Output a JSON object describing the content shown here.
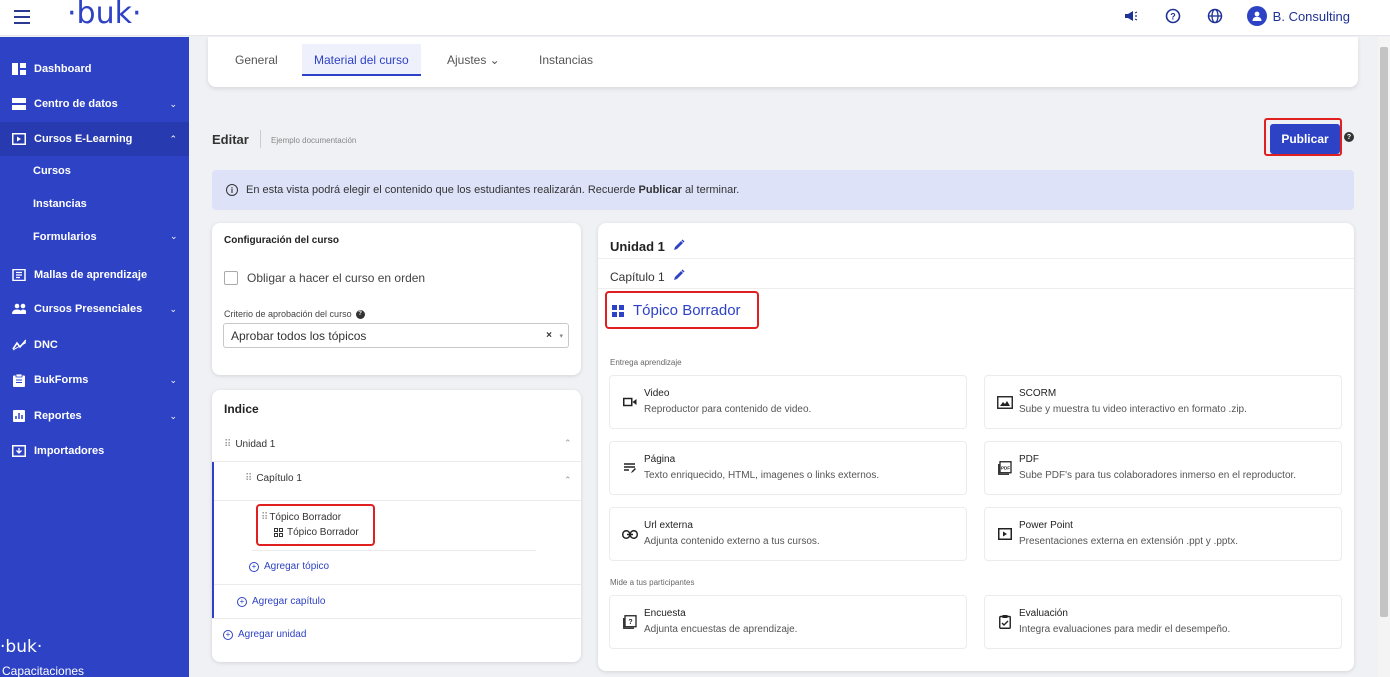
{
  "app": {
    "logo": "·buk·",
    "footer_logo": "·buk·",
    "footer_text": "Capacitaciones"
  },
  "header": {
    "user_name": "B. Consulting",
    "user_initial": "●"
  },
  "sidebar": {
    "items": [
      {
        "label": "Dashboard",
        "icon": "dashboard-icon"
      },
      {
        "label": "Centro de datos",
        "icon": "database-icon",
        "chevron": "⌄"
      },
      {
        "label": "Cursos E-Learning",
        "icon": "play-icon",
        "chevron": "⌃"
      },
      {
        "label": "Mallas de aprendizaje",
        "icon": "book-icon"
      },
      {
        "label": "Cursos Presenciales",
        "icon": "people-icon",
        "chevron": "⌄"
      },
      {
        "label": "DNC",
        "icon": "chart-icon"
      },
      {
        "label": "BukForms",
        "icon": "clipboard-icon",
        "chevron": "⌄"
      },
      {
        "label": "Reportes",
        "icon": "report-icon",
        "chevron": "⌄"
      },
      {
        "label": "Importadores",
        "icon": "import-icon"
      }
    ],
    "subitems": [
      {
        "label": "Cursos"
      },
      {
        "label": "Instancias"
      },
      {
        "label": "Formularios",
        "chevron": "⌄"
      }
    ]
  },
  "tabs": [
    {
      "label": "General"
    },
    {
      "label": "Material del curso"
    },
    {
      "label": "Ajustes ⌄"
    },
    {
      "label": "Instancias"
    }
  ],
  "editor": {
    "title": "Editar",
    "subtitle": "Ejemplo documentación",
    "publish": "Publicar",
    "help": "?"
  },
  "info": {
    "before": "En esta vista podrá elegir el contenido que los estudiantes realizarán. Recuerde",
    "bold": "Publicar",
    "after": "al terminar."
  },
  "config": {
    "title": "Configuración del curso",
    "checkbox_label": "Obligar a hacer el curso en orden",
    "criterion_label": "Criterio de aprobación del curso",
    "criterion_value": "Aprobar todos los tópicos",
    "clear": "×",
    "dropdown": "▾"
  },
  "index": {
    "title": "Indice",
    "unit": "Unidad 1",
    "chapter": "Capítulo 1",
    "topic_name": "Tópico Borrador",
    "topic_sub": "Tópico Borrador",
    "add_topic": "Agregar tópico",
    "add_chapter": "Agregar capítulo",
    "add_unit": "Agregar unidad",
    "chev": "⌃",
    "drag": "⠿"
  },
  "content": {
    "unit": "Unidad 1",
    "chapter": "Capítulo 1",
    "topic": "Tópico Borrador",
    "section_learning": "Entrega aprendizaje",
    "section_measure": "Mide a tus participantes",
    "options": [
      {
        "title": "Video",
        "desc": "Reproductor para contenido de video.",
        "icon": "video-icon",
        "glyph": "▭◂"
      },
      {
        "title": "SCORM",
        "desc": "Sube y muestra tu video interactivo en formato .zip.",
        "icon": "image-icon",
        "glyph": "🖾"
      },
      {
        "title": "Página",
        "desc": "Texto enriquecido, HTML, imagenes o links externos.",
        "icon": "text-edit-icon",
        "glyph": "≡"
      },
      {
        "title": "PDF",
        "desc": "Sube PDF's para tus colaboradores inmerso en el reproductor.",
        "icon": "pdf-icon",
        "glyph": "▤"
      },
      {
        "title": "Url externa",
        "desc": "Adjunta contenido externo a tus cursos.",
        "icon": "link-icon",
        "glyph": "⊂⊃"
      },
      {
        "title": "Power Point",
        "desc": "Presentaciones externa en extensión .ppt y .pptx.",
        "icon": "slides-icon",
        "glyph": "▶"
      },
      {
        "title": "Encuesta",
        "desc": "Adjunta encuestas de aprendizaje.",
        "icon": "survey-icon",
        "glyph": "⍰"
      },
      {
        "title": "Evaluación",
        "desc": "Integra evaluaciones para medir el desempeño.",
        "icon": "evaluation-icon",
        "glyph": "☑"
      }
    ]
  },
  "colors": {
    "brand": "#2e42c5",
    "highlight": "#e02020",
    "info_bg": "#dde2f8"
  }
}
